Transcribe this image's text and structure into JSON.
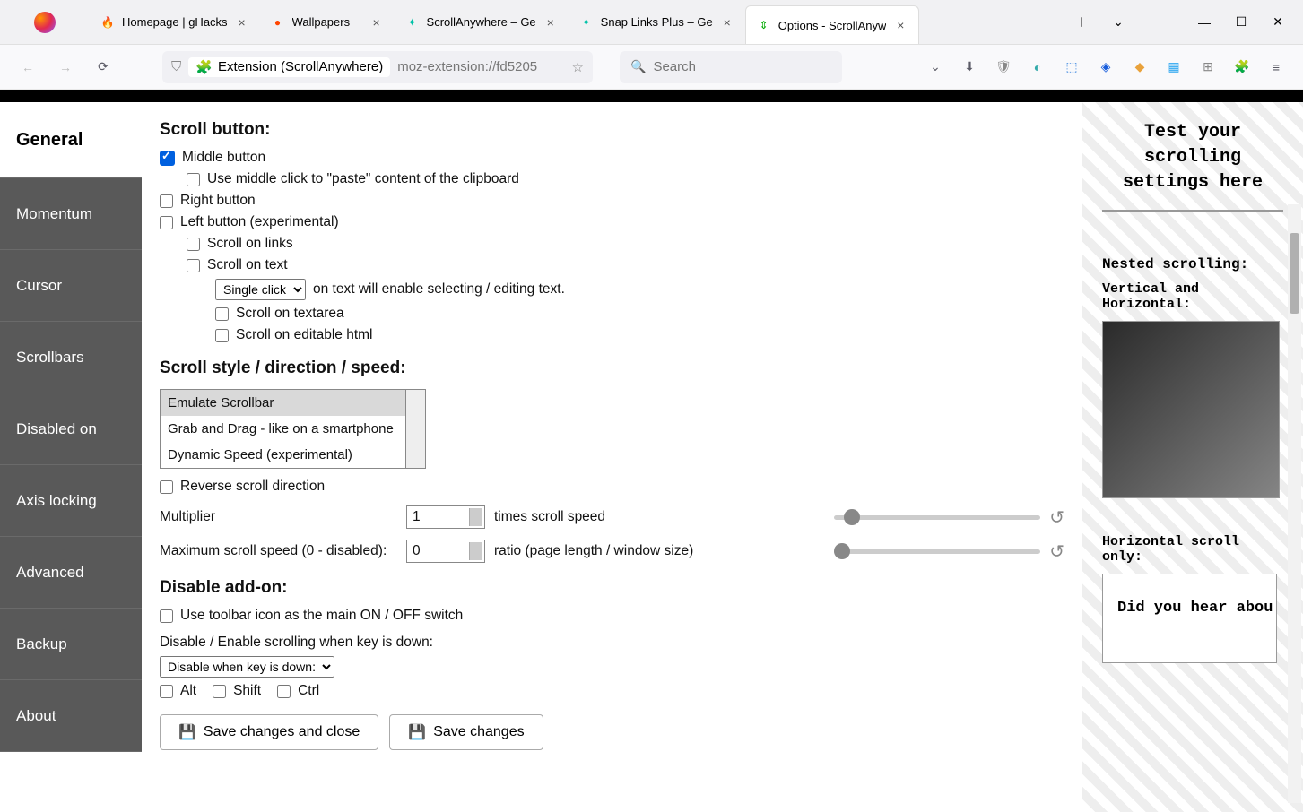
{
  "tabs": [
    {
      "label": "Homepage | gHacks"
    },
    {
      "label": "Wallpapers"
    },
    {
      "label": "ScrollAnywhere – Ge"
    },
    {
      "label": "Snap Links Plus – Ge"
    },
    {
      "label": "Options - ScrollAnyw",
      "active": true
    }
  ],
  "urlbar": {
    "prefix": "Extension (ScrollAnywhere)",
    "rest": "moz-extension://fd5205"
  },
  "searchbar": {
    "placeholder": "Search"
  },
  "sidebar": {
    "items": [
      "General",
      "Momentum",
      "Cursor",
      "Scrollbars",
      "Disabled on",
      "Axis locking",
      "Advanced",
      "Backup",
      "About"
    ]
  },
  "main": {
    "h_scrollbutton": "Scroll button:",
    "cb_middle": "Middle button",
    "cb_paste": "Use middle click to \"paste\" content of the clipboard",
    "cb_right": "Right button",
    "cb_left": "Left button (experimental)",
    "cb_scrolllinks": "Scroll on links",
    "cb_scrolltext": "Scroll on text",
    "sel_click_opt": "Single click",
    "txt_enable_select": "on text will enable selecting / editing text.",
    "cb_textarea": "Scroll on textarea",
    "cb_editable": "Scroll on editable html",
    "h_style": "Scroll style / direction / speed:",
    "listbox": [
      "Emulate Scrollbar",
      "Grab and Drag - like on a smartphone",
      "Dynamic Speed (experimental)"
    ],
    "cb_reverse": "Reverse scroll direction",
    "lbl_mult": "Multiplier",
    "val_mult": "1",
    "txt_multsuffix": "times scroll speed",
    "lbl_max": "Maximum scroll speed (0 - disabled):",
    "val_max": "0",
    "txt_maxsuffix": "ratio (page length / window size)",
    "h_disable": "Disable add-on:",
    "cb_toolbar": "Use toolbar icon as the main ON / OFF switch",
    "txt_keydown": "Disable / Enable scrolling when key is down:",
    "sel_keydown": "Disable when key is down:",
    "cb_alt": "Alt",
    "cb_shift": "Shift",
    "cb_ctrl": "Ctrl",
    "btn_save_close": "Save changes and close",
    "btn_save": "Save changes"
  },
  "test": {
    "heading": "Test your scrolling settings here",
    "nested": "Nested scrolling:",
    "vh": "Vertical and Horizontal:",
    "honly": "Horizontal scroll only:",
    "htext": "Did you hear abou"
  }
}
